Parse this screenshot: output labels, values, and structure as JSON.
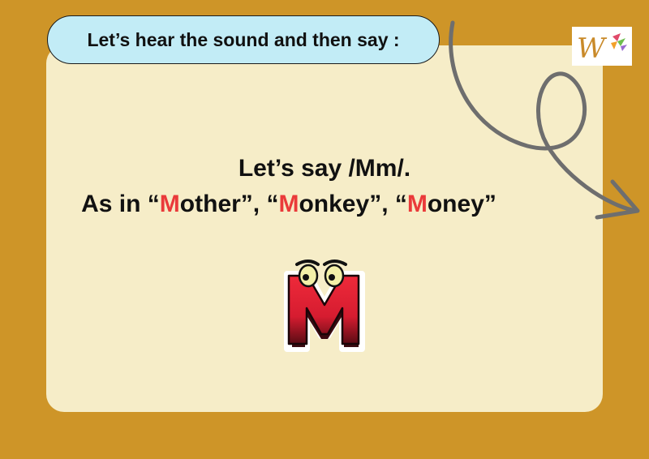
{
  "instruction": {
    "text": "Let’s hear the sound and then say :"
  },
  "headline": {
    "line1": "Let’s say /Mm/.",
    "line2_prefix": "As in “",
    "examples": [
      {
        "highlight": "M",
        "rest": "other"
      },
      {
        "highlight": "M",
        "rest": "onkey"
      },
      {
        "highlight": "M",
        "rest": "oney"
      }
    ],
    "separator": "”, “",
    "line2_suffix": "”"
  },
  "logo": {
    "icon": "w-logo-icon"
  },
  "decor": {
    "arrow_icon": "curly-arrow-icon",
    "letter_icon": "cartoon-letter-m-icon"
  },
  "colors": {
    "background": "#ce9528",
    "card": "#f6edc8",
    "instruction_bubble": "#c2ecf6",
    "highlight": "#ea3a3a",
    "arrow": "#6e6e6e"
  }
}
